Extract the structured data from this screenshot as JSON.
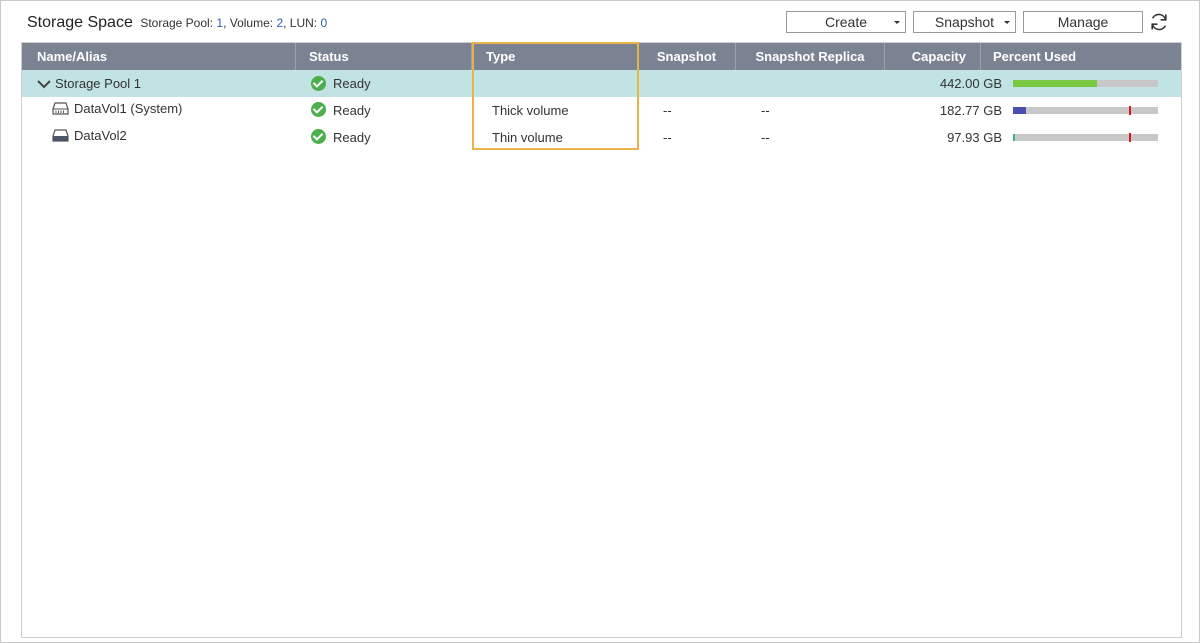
{
  "header": {
    "title": "Storage Space",
    "summary": {
      "pool_label": "Storage Pool: ",
      "pool_count": "1",
      "volume_label": ", Volume: ",
      "volume_count": "2",
      "lun_label": ", LUN: ",
      "lun_count": "0"
    },
    "buttons": {
      "create": "Create",
      "snapshot": "Snapshot",
      "manage": "Manage"
    }
  },
  "table": {
    "columns": [
      "Name/Alias",
      "Status",
      "Type",
      "Snapshot",
      "Snapshot Replica",
      "Capacity",
      "Percent Used"
    ],
    "rows": [
      {
        "name": "Storage Pool 1",
        "status": "Ready",
        "type": "",
        "snapshot": "",
        "snapshot_replica": "",
        "capacity": "442.00 GB",
        "percent_used": 0.58,
        "bar_color": "#7ac943",
        "threshold": null
      },
      {
        "name": "DataVol1 (System)",
        "status": "Ready",
        "type": "Thick volume",
        "snapshot": "--",
        "snapshot_replica": "--",
        "capacity": "182.77 GB",
        "percent_used": 0.09,
        "bar_color": "#4a4fb0",
        "threshold": 0.8
      },
      {
        "name": "DataVol2",
        "status": "Ready",
        "type": "Thin volume",
        "snapshot": "--",
        "snapshot_replica": "--",
        "capacity": "97.93 GB",
        "percent_used": 0.015,
        "bar_color": "#3fb27f",
        "threshold": 0.8
      }
    ]
  },
  "colors": {
    "header_bg": "#7b8291",
    "selected_row": "#c1e3e3",
    "highlight_box": "#e8b44a",
    "ready_check": "#4cae4c"
  }
}
